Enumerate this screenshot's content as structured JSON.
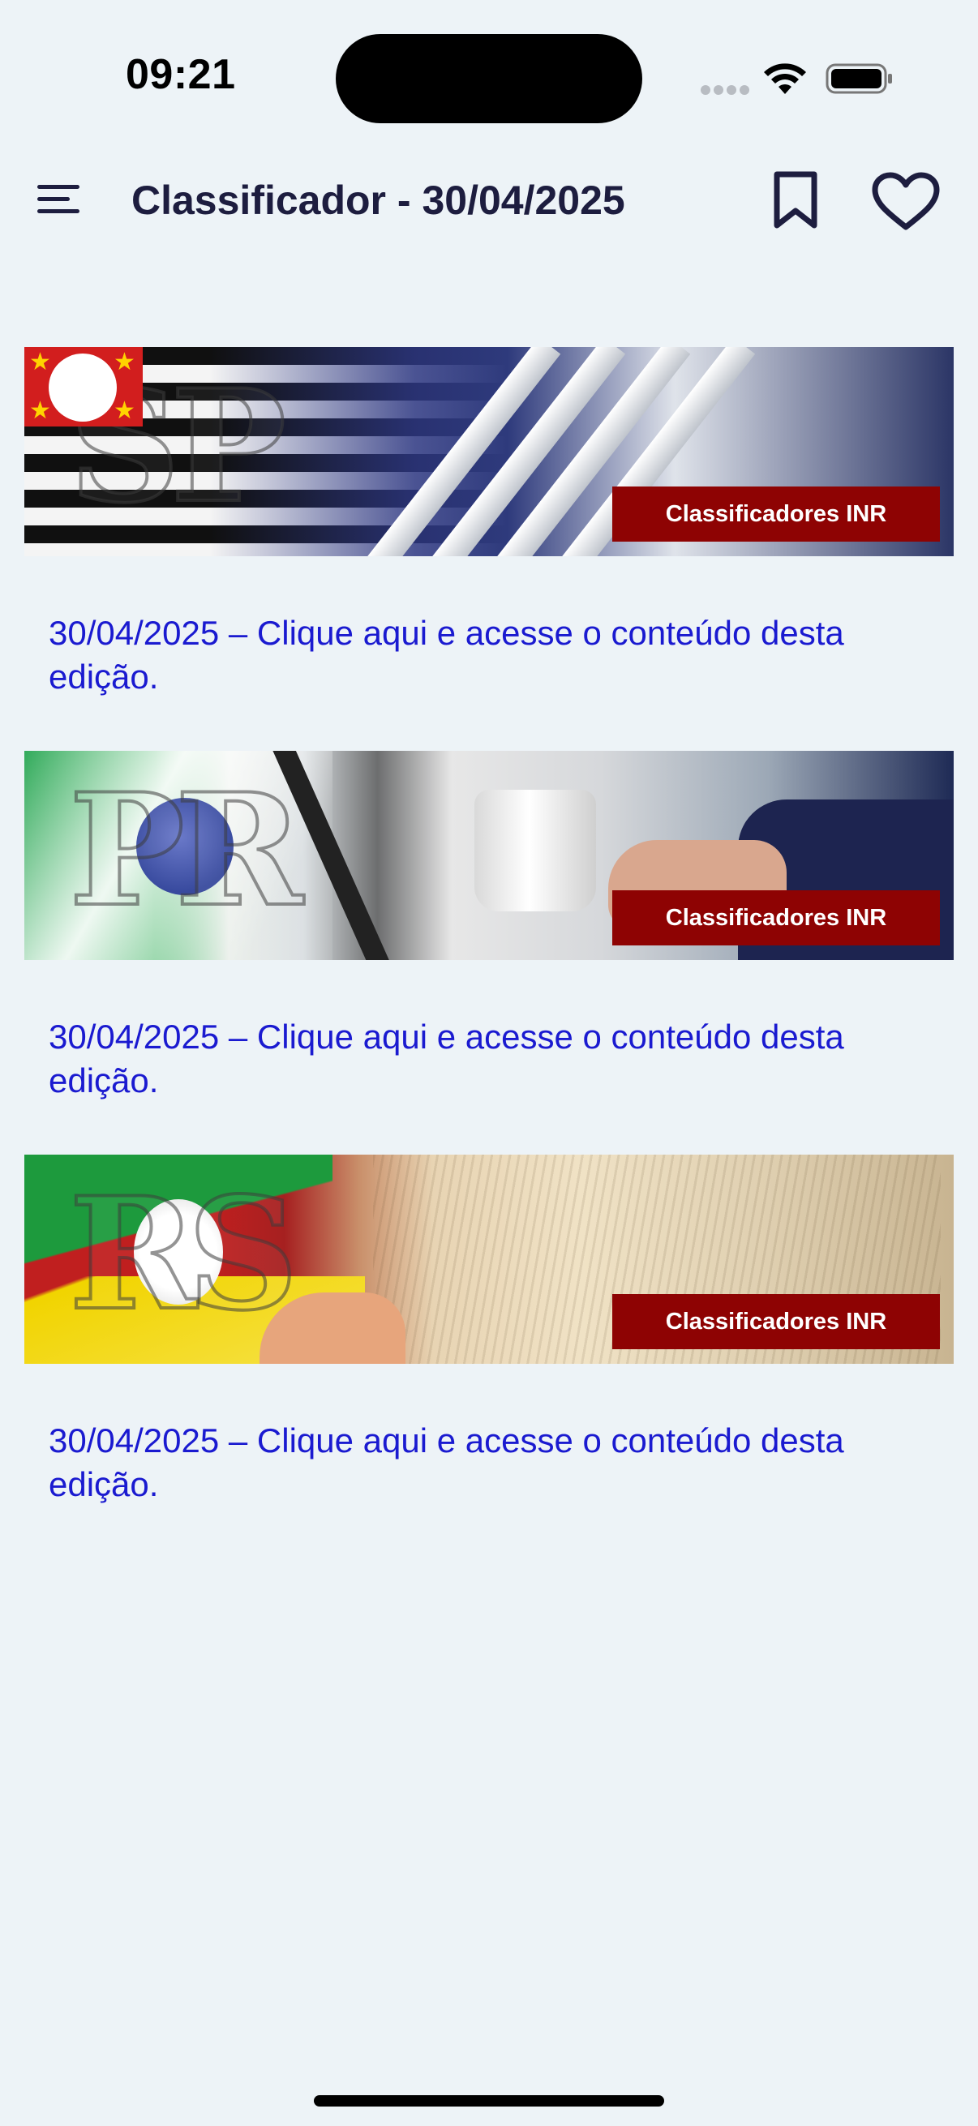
{
  "status_bar": {
    "time": "09:21"
  },
  "app_bar": {
    "title": "Classificador - 30/04/2025",
    "icons": [
      "menu-icon",
      "bookmark-icon",
      "heart-icon"
    ]
  },
  "cards": [
    {
      "state": "SP",
      "banner_label": "Classificadores INR",
      "link_text": "30/04/2025 – Clique aqui e acesse o conteúdo desta edição."
    },
    {
      "state": "PR",
      "banner_label": "Classificadores INR",
      "link_text": "30/04/2025 – Clique aqui e acesse o conteúdo desta edição."
    },
    {
      "state": "RS",
      "banner_label": "Classificadores INR",
      "link_text": "30/04/2025 – Clique aqui e acesse o conteúdo desta edição."
    }
  ],
  "colors": {
    "background": "#edf3f7",
    "title": "#1d1d3f",
    "link": "#1a1ad0",
    "badge": "#8e0303"
  }
}
